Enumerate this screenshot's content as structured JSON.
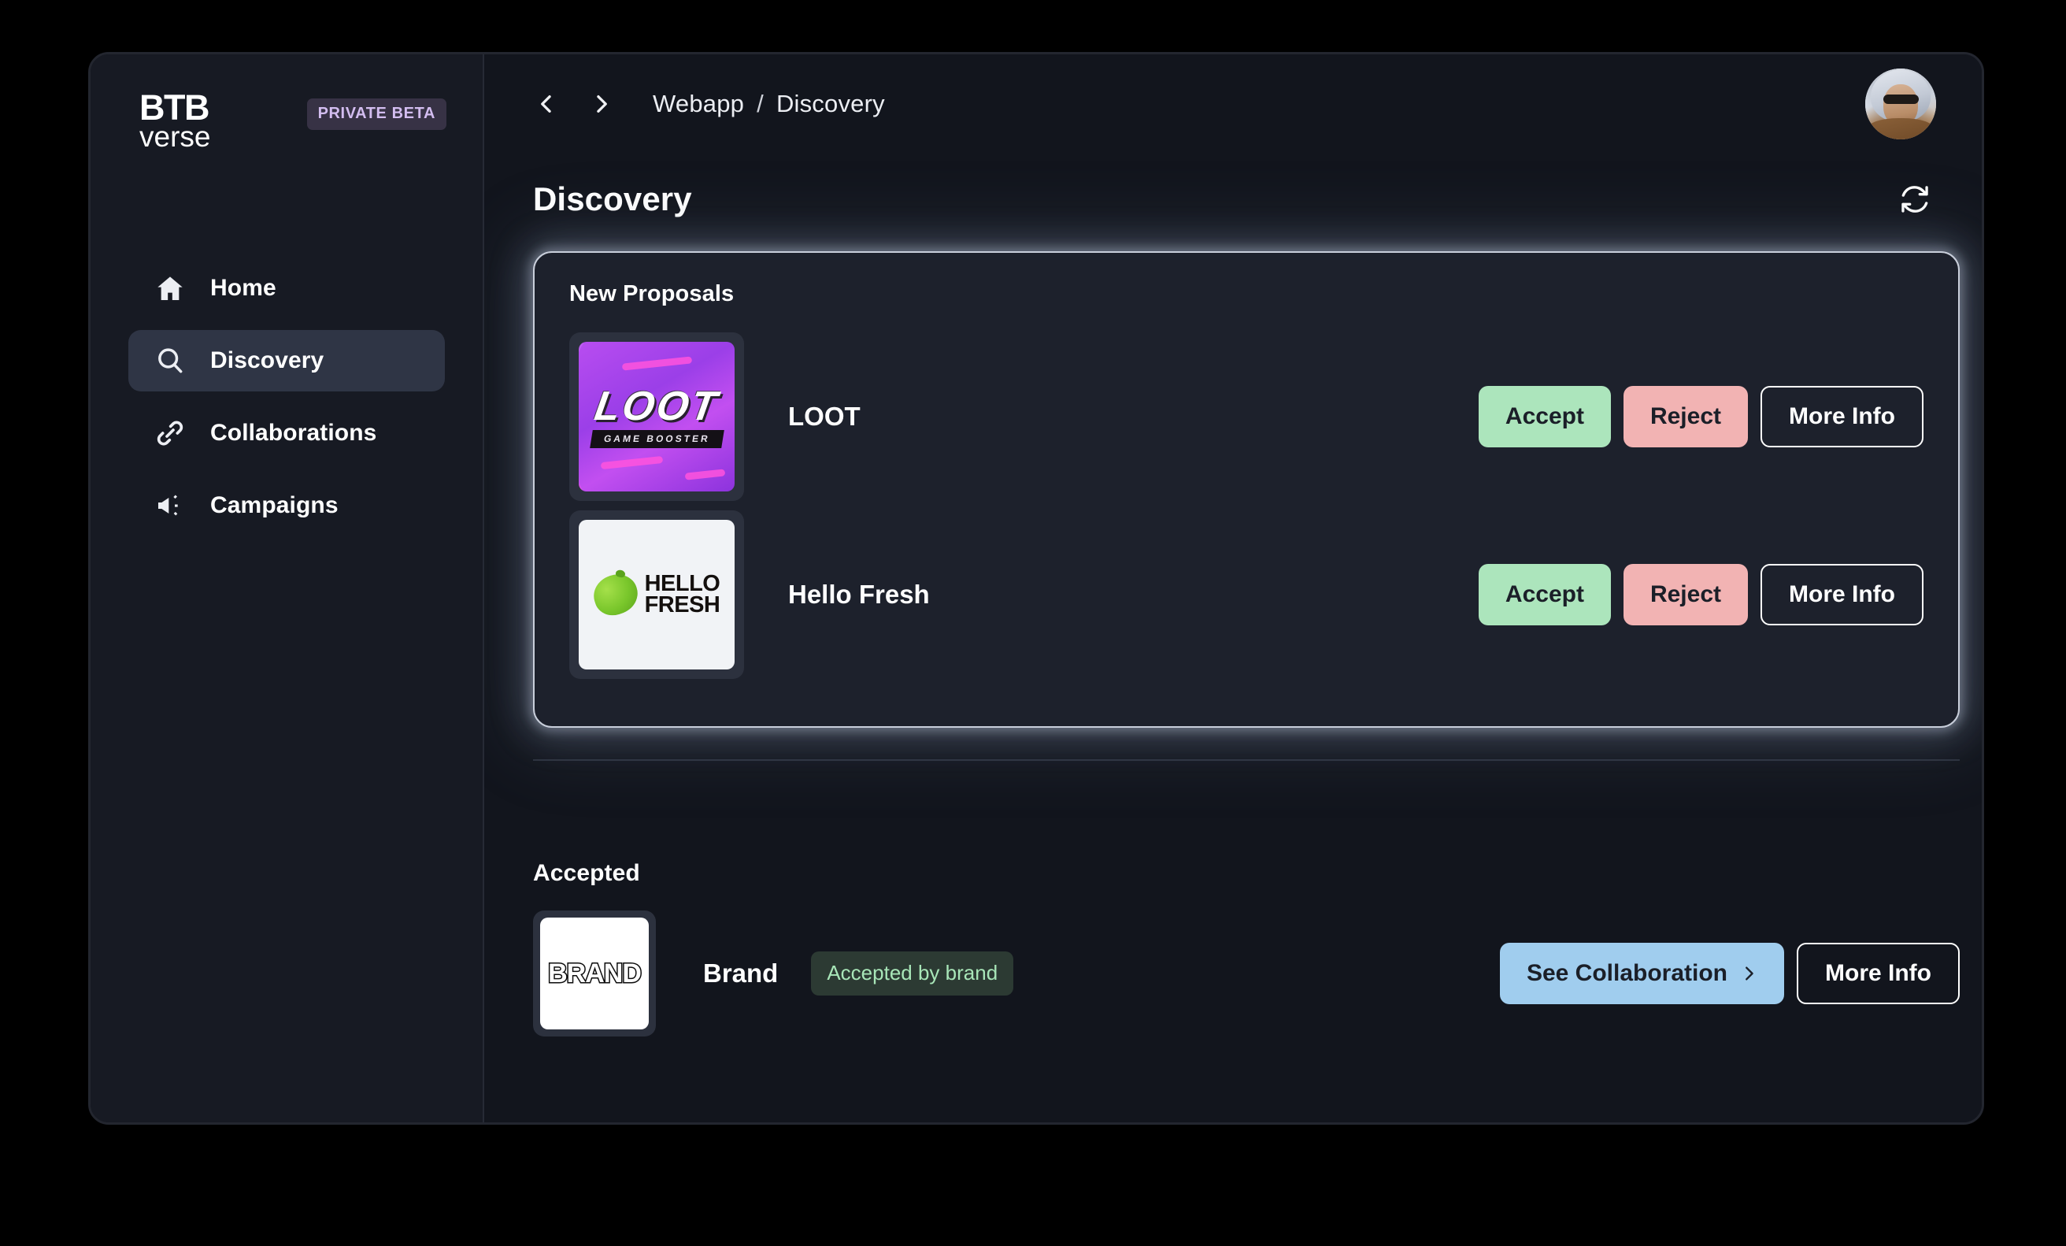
{
  "sidebar": {
    "logo": {
      "top": "BTB",
      "bottom": "verse"
    },
    "badge": "PRIVATE BETA",
    "items": [
      {
        "label": "Home",
        "icon": "home-icon",
        "active": false
      },
      {
        "label": "Discovery",
        "icon": "search-icon",
        "active": true
      },
      {
        "label": "Collaborations",
        "icon": "link-icon",
        "active": false
      },
      {
        "label": "Campaigns",
        "icon": "megaphone-icon",
        "active": false
      }
    ]
  },
  "topbar": {
    "back_icon": "chevron-left-icon",
    "forward_icon": "chevron-right-icon",
    "breadcrumb": {
      "root": "Webapp",
      "separator": "/",
      "current": "Discovery"
    },
    "avatar_icon": "user-avatar"
  },
  "page": {
    "title": "Discovery",
    "refresh_icon": "refresh-icon"
  },
  "proposals_card": {
    "title": "New Proposals",
    "rows": [
      {
        "name": "LOOT",
        "logo": {
          "type": "loot-logo",
          "wordmark": "LOOT",
          "tagline": "GAME BOOSTER"
        },
        "actions": {
          "accept": "Accept",
          "reject": "Reject",
          "more_info": "More Info"
        }
      },
      {
        "name": "Hello Fresh",
        "logo": {
          "type": "hellofresh-logo",
          "line1": "HELLO",
          "line2": "FRESH"
        },
        "actions": {
          "accept": "Accept",
          "reject": "Reject",
          "more_info": "More Info"
        }
      }
    ]
  },
  "accepted_section": {
    "title": "Accepted",
    "rows": [
      {
        "name": "Brand",
        "logo": {
          "type": "brand-logo",
          "wordmark": "BRAND"
        },
        "status": "Accepted by brand",
        "actions": {
          "see_collaboration": "See Collaboration",
          "more_info": "More Info"
        }
      }
    ]
  },
  "colors": {
    "page_background": "#12151d",
    "sidebar_background": "#171a23",
    "card_background": "#1d212c",
    "accept_green": "#ace5bc",
    "reject_pink": "#f2b3b3",
    "collab_blue": "#a0cdee",
    "badge_purple_bg": "#373245",
    "badge_purple_text": "#d3bdf0",
    "status_badge_bg": "#2c3a33",
    "status_badge_text": "#a8e6b8"
  }
}
